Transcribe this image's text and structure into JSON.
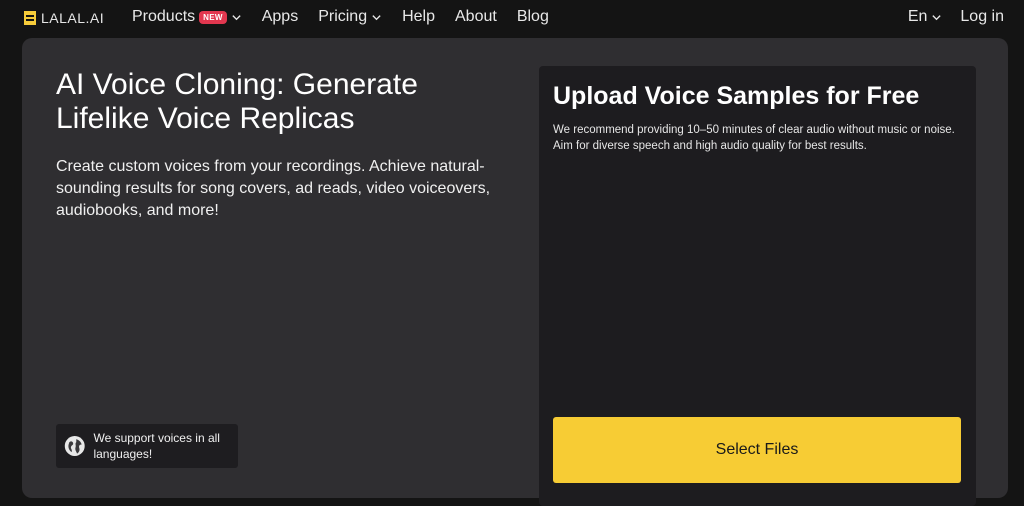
{
  "header": {
    "logo_text": "LALAL.AI",
    "nav": {
      "products": "Products",
      "products_badge": "NEW",
      "apps": "Apps",
      "pricing": "Pricing",
      "help": "Help",
      "about": "About",
      "blog": "Blog"
    },
    "language": "En",
    "login": "Log in"
  },
  "hero": {
    "title": "AI Voice Cloning: Generate Lifelike Voice Replicas",
    "description": "Create custom voices from your recordings. Achieve natural-sounding results for song covers, ad reads, video voiceovers, audiobooks, and more!",
    "languages_note": "We support voices in all languages!"
  },
  "upload": {
    "title": "Upload Voice Samples for Free",
    "description": "We recommend providing 10–50 minutes of clear audio without music or noise. Aim for diverse speech and high audio quality for best results.",
    "button_label": "Select Files"
  },
  "colors": {
    "accent": "#f7cc34",
    "badge": "#e2374f",
    "panel": "#2f2e31",
    "card": "#1d1c1f",
    "background": "#141414"
  },
  "icons": {
    "logo": "lalal-logo-icon",
    "chevron": "chevron-down-icon",
    "globe": "globe-icon"
  }
}
